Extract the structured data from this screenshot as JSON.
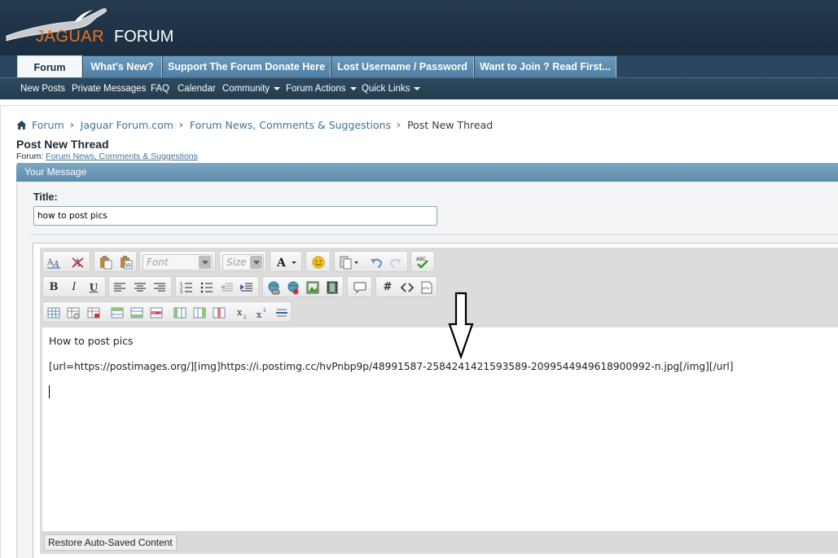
{
  "logo": {
    "word1": "JAGUAR",
    "word2": "FORUM"
  },
  "tabs": [
    {
      "label": "Forum",
      "active": true
    },
    {
      "label": "What's New?"
    },
    {
      "label": "Support The Forum Donate Here"
    },
    {
      "label": "Lost Username / Password"
    },
    {
      "label": "Want to Join ? Read First..."
    }
  ],
  "subnav": [
    {
      "label": "New Posts"
    },
    {
      "label": "Private Messages"
    },
    {
      "label": "FAQ"
    },
    {
      "label": "Calendar"
    },
    {
      "label": "Community",
      "dropdown": true
    },
    {
      "label": "Forum Actions",
      "dropdown": true
    },
    {
      "label": "Quick Links",
      "dropdown": true
    }
  ],
  "breadcrumb": {
    "items": [
      "Forum",
      "Jaguar Forum.com",
      "Forum News, Comments & Suggestions"
    ],
    "current": "Post New Thread"
  },
  "page": {
    "title": "Post New Thread",
    "forum_label": "Forum:",
    "forum_link": "Forum News, Comments & Suggestions"
  },
  "panel": {
    "heading": "Your Message"
  },
  "form": {
    "title_label": "Title:",
    "title_value": "how to post pics"
  },
  "editor": {
    "font_placeholder": "Font",
    "size_placeholder": "Size",
    "line1": "How to post pics",
    "line2": "[url=https://postimages.org/][img]https://i.postimg.cc/hvPnbp9p/48991587-2584241421593589-2099544949618900992-n.jpg[/img][/url]",
    "restore_label": "Restore Auto-Saved Content"
  },
  "icons": {
    "home": "home-icon",
    "breadcrumb_separator": "arrow-right-icon",
    "annotation_arrow": "down-arrow-annotation"
  },
  "colors": {
    "header_bg": "#1f3346",
    "tab_bg": "#5b8aad",
    "link": "#417394",
    "panel_head": "#6a95b6",
    "logo_orange": "#e8741e"
  }
}
